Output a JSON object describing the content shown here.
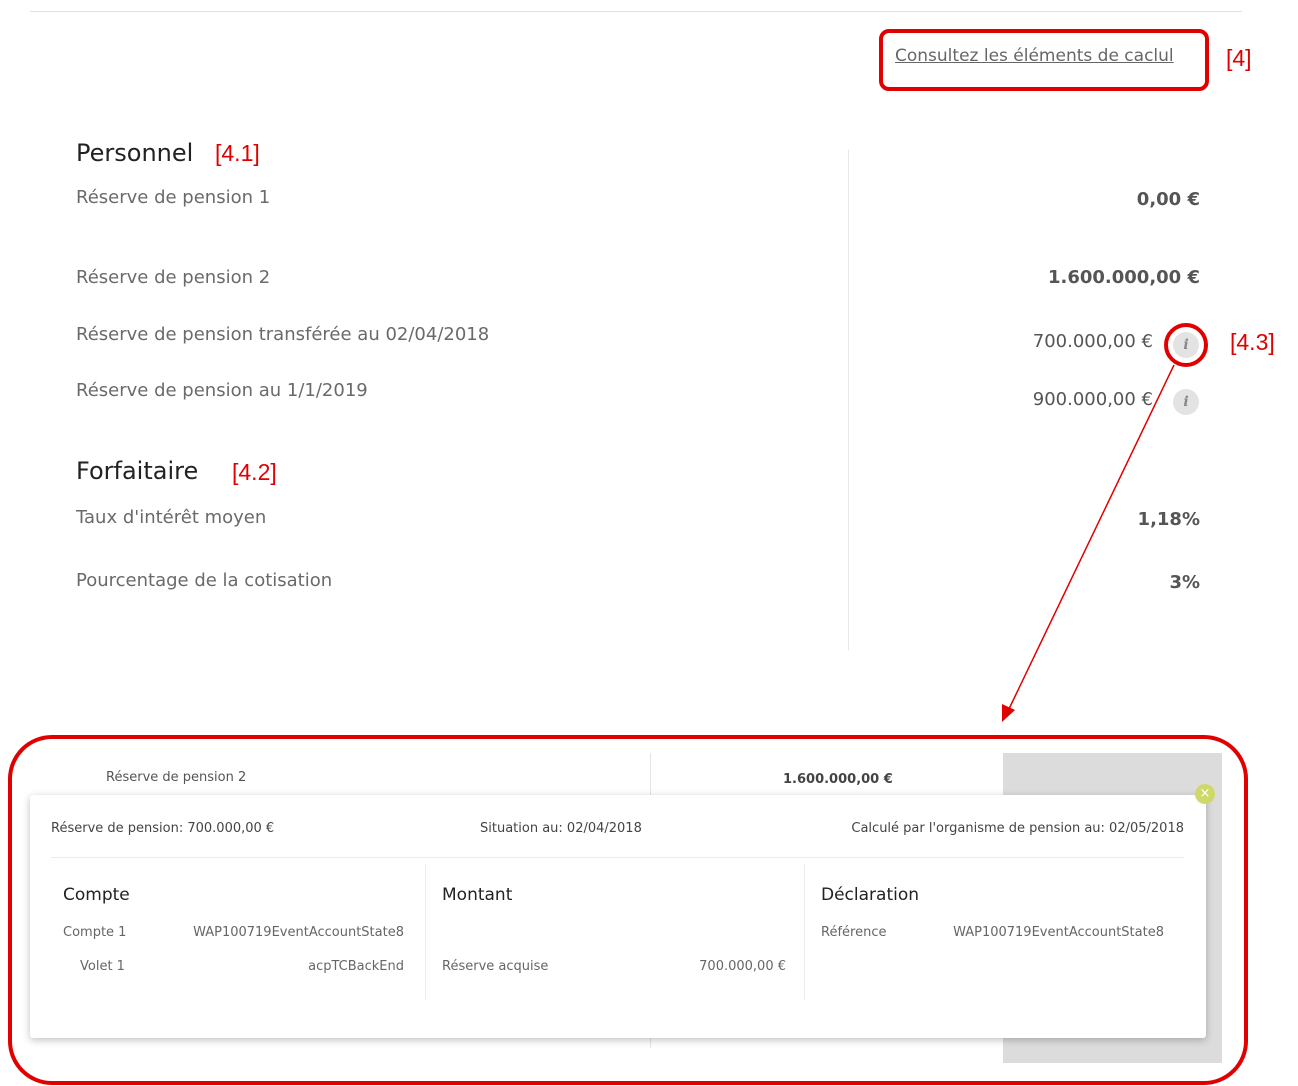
{
  "link": {
    "label": "Consultez les éléments de caclul"
  },
  "tags": {
    "t4": "[4]",
    "t41": "[4.1]",
    "t42": "[4.2]",
    "t43": "[4.3]"
  },
  "sections": {
    "personnel": {
      "title": "Personnel",
      "rows": [
        {
          "label": "Réserve de pension 1",
          "value": "0,00 €"
        },
        {
          "label": "Réserve de pension 2",
          "value": "1.600.000,00 €"
        },
        {
          "label": "Réserve de pension transférée au 02/04/2018",
          "value": "700.000,00 €"
        },
        {
          "label": "Réserve de pension au 1/1/2019",
          "value": "900.000,00 €"
        }
      ]
    },
    "forfaitaire": {
      "title": "Forfaitaire",
      "rows": [
        {
          "label": "Taux d'intérêt moyen",
          "value": "1,18%"
        },
        {
          "label": "Pourcentage de la cotisation",
          "value": "3%"
        }
      ]
    }
  },
  "info_icon": {
    "glyph": "i",
    "name": "info-icon"
  },
  "detail": {
    "bg_row": {
      "label": "Réserve de pension 2",
      "value": "1.600.000,00 €"
    },
    "popup": {
      "close_glyph": "×",
      "header": {
        "reserve": "Réserve de pension: 700.000,00 €",
        "situation": "Situation au: 02/04/2018",
        "calcule": "Calculé par l'organisme de pension au: 02/05/2018"
      },
      "compte": {
        "title": "Compte",
        "rows": [
          {
            "label": "Compte 1",
            "value": "WAP100719EventAccountState8"
          },
          {
            "label": "Volet 1",
            "value": "acpTCBackEnd"
          }
        ]
      },
      "montant": {
        "title": "Montant",
        "row": {
          "label": "Réserve acquise",
          "value": "700.000,00 €"
        }
      },
      "declaration": {
        "title": "Déclaration",
        "row": {
          "label": "Référence",
          "value": "WAP100719EventAccountState8"
        }
      }
    }
  },
  "colors": {
    "annotation_red": "#e00000",
    "close_green": "#cfd96b"
  }
}
